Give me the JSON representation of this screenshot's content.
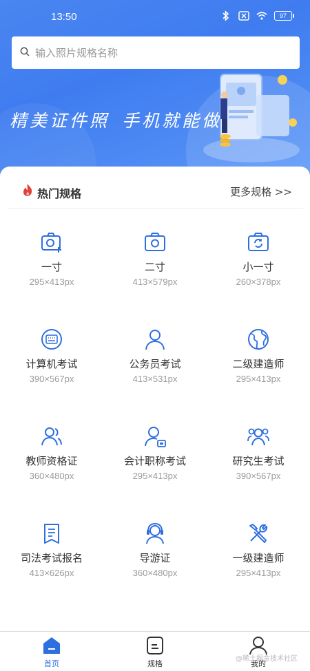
{
  "status": {
    "time": "13:50",
    "battery": "97"
  },
  "search": {
    "placeholder": "输入照片规格名称"
  },
  "banner": {
    "text": "精美证件照 手机就能做"
  },
  "section": {
    "title": "热门规格",
    "more": "更多规格 >>"
  },
  "specs": [
    {
      "name": "一寸",
      "size": "295×413px",
      "icon": "camera-plus-icon"
    },
    {
      "name": "二寸",
      "size": "413×579px",
      "icon": "camera-icon"
    },
    {
      "name": "小一寸",
      "size": "260×378px",
      "icon": "camera-rotate-icon"
    },
    {
      "name": "计算机考试",
      "size": "390×567px",
      "icon": "keyboard-icon"
    },
    {
      "name": "公务员考试",
      "size": "413×531px",
      "icon": "person-icon"
    },
    {
      "name": "二级建造师",
      "size": "295×413px",
      "icon": "globe-icon"
    },
    {
      "name": "教师资格证",
      "size": "360×480px",
      "icon": "people-icon"
    },
    {
      "name": "会计职称考试",
      "size": "295×413px",
      "icon": "person-card-icon"
    },
    {
      "name": "研究生考试",
      "size": "390×567px",
      "icon": "group-icon"
    },
    {
      "name": "司法考试报名",
      "size": "413×626px",
      "icon": "document-icon"
    },
    {
      "name": "导游证",
      "size": "360×480px",
      "icon": "headset-person-icon"
    },
    {
      "name": "一级建造师",
      "size": "295×413px",
      "icon": "tools-icon"
    }
  ],
  "nav": [
    {
      "label": "首页",
      "icon": "home-icon",
      "active": true
    },
    {
      "label": "规格",
      "icon": "spec-list-icon",
      "active": false
    },
    {
      "label": "我的",
      "icon": "profile-icon",
      "active": false
    }
  ],
  "watermark": "@稀土掘金技术社区",
  "colors": {
    "primary": "#2e6fe0",
    "header": "#4a86f0",
    "fire": "#e0423a"
  }
}
